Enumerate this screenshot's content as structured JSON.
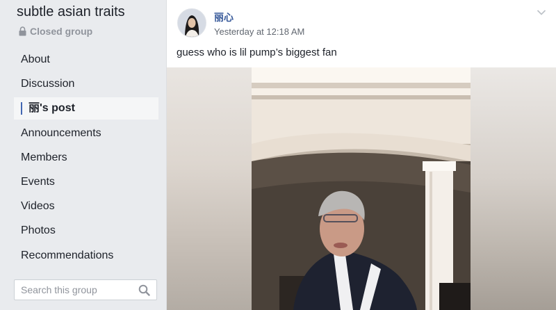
{
  "sidebar": {
    "group_name": "subtle asian traits",
    "group_type": "Closed group",
    "lock_icon": "lock-icon",
    "nav_items": [
      {
        "label": "About"
      },
      {
        "label": "Discussion"
      },
      {
        "label": "丽's post",
        "active": true
      },
      {
        "label": "Announcements"
      },
      {
        "label": "Members"
      },
      {
        "label": "Events"
      },
      {
        "label": "Videos"
      },
      {
        "label": "Photos"
      },
      {
        "label": "Recommendations"
      }
    ],
    "search": {
      "placeholder": "Search this group",
      "value": "",
      "icon": "search-icon"
    }
  },
  "post": {
    "author": "丽心",
    "timestamp": "Yesterday at 12:18 AM",
    "text": "guess who is lil pump’s biggest fan",
    "menu_icon": "chevron-down-icon",
    "media_type": "video"
  },
  "colors": {
    "background": "#e9ebee",
    "link_blue": "#365899",
    "active_marker": "#4267b2",
    "text_primary": "#1d2129",
    "text_secondary": "#90949c"
  }
}
